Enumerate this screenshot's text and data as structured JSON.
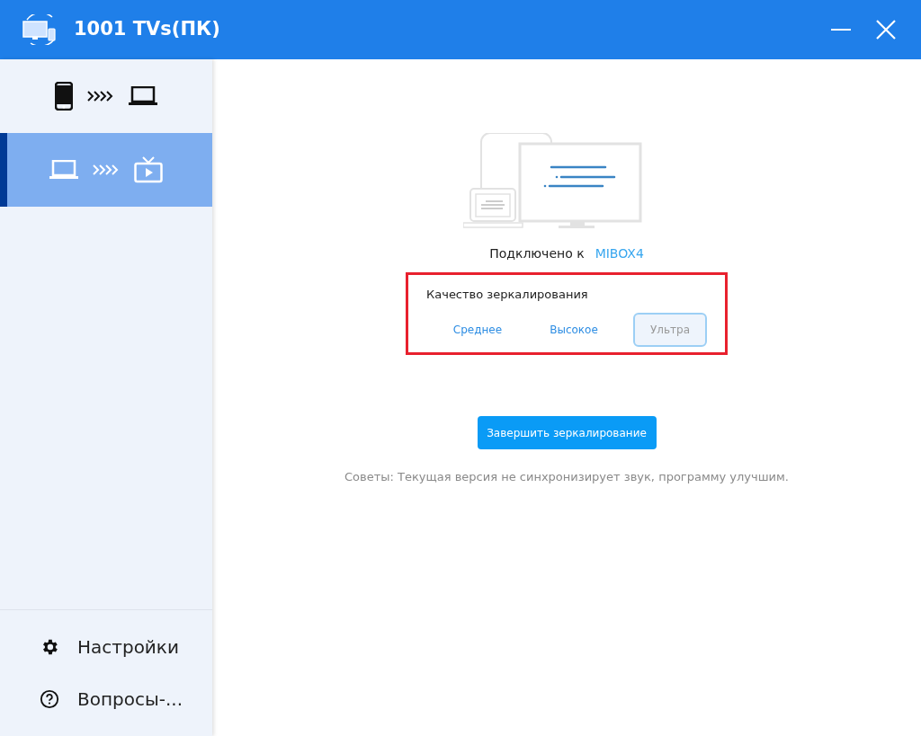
{
  "window": {
    "title": "1001 TVs(ПК)"
  },
  "modes": [
    {
      "kind": "phone-to-pc",
      "selected": false
    },
    {
      "kind": "pc-to-tv",
      "selected": true
    }
  ],
  "footer_menu": [
    {
      "kind": "settings",
      "label": "Настройки"
    },
    {
      "kind": "help",
      "label": "Вопросы-..."
    }
  ],
  "status": {
    "label": "Подключено к",
    "device": "MIBOX4"
  },
  "quality": {
    "title": "Качество зеркалирования",
    "highlighted": true,
    "options": [
      {
        "label": "Среднее",
        "selected": false
      },
      {
        "label": "Высокое",
        "selected": false
      },
      {
        "label": "Ультра",
        "selected": true
      }
    ]
  },
  "stop_button": "Завершить зеркалирование",
  "tip": "Советы: Текущая версия не синхронизирует звук, программу улучшим."
}
